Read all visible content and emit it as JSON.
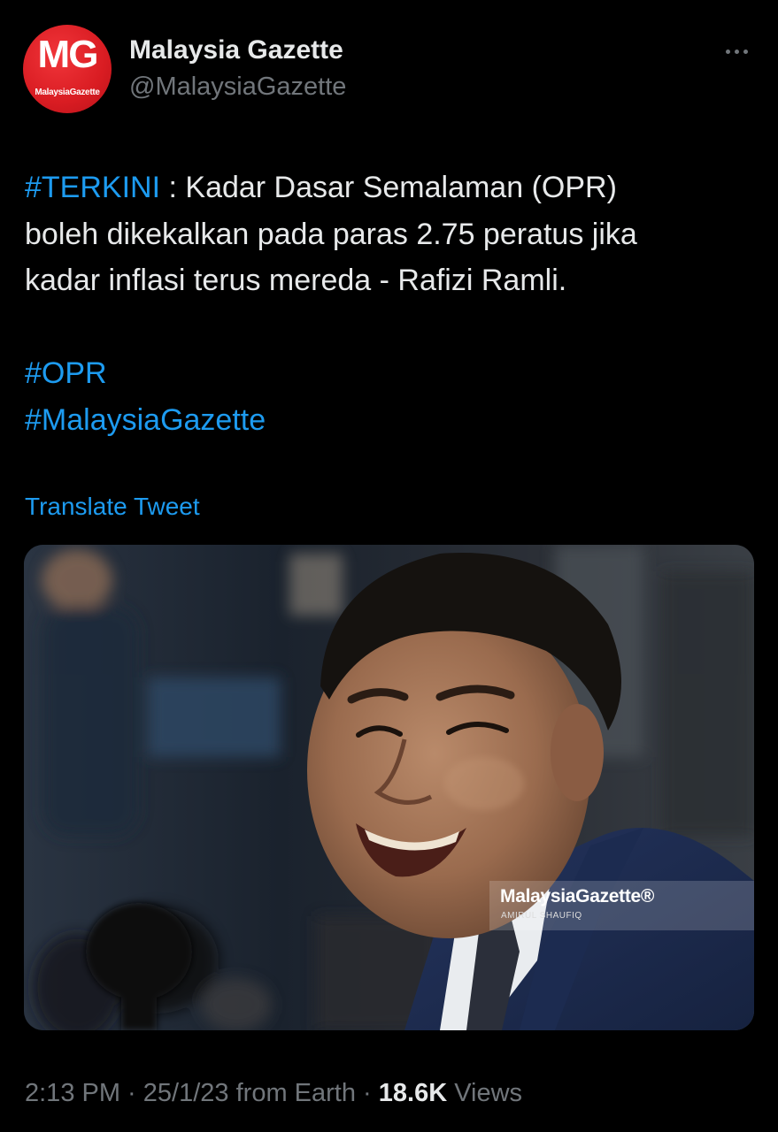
{
  "tweet": {
    "author": {
      "display_name": "Malaysia Gazette",
      "handle": "@MalaysiaGazette",
      "avatar_initials_m": "M",
      "avatar_initials_g": "G",
      "avatar_subtext": "MalaysiaGazette"
    },
    "more_icon": "more-horizontal-icon",
    "text": {
      "hashtag_terkini": "#TERKINI",
      "line1_rest": " : Kadar Dasar Semalaman (OPR)",
      "line2": "boleh dikekalkan pada paras 2.75 peratus jika",
      "line3": "kadar inflasi terus mereda - Rafizi Ramli.",
      "hashtag_opr": "#OPR",
      "hashtag_mg": "#MalaysiaGazette"
    },
    "translate_label": "Translate Tweet",
    "media": {
      "watermark_brand": "MalaysiaGazette®",
      "watermark_credit": "AMIRUL SHAUFIQ"
    },
    "meta": {
      "time": "2:13 PM",
      "separator1": " · ",
      "date": "25/1/23",
      "source": " from Earth",
      "separator2": " · ",
      "views_count": "18.6K",
      "views_label": " Views"
    }
  },
  "colors": {
    "background": "#000000",
    "text_primary": "#e7e9ea",
    "text_secondary": "#71767b",
    "link": "#1d9bf0",
    "avatar_red": "#d91c22"
  }
}
